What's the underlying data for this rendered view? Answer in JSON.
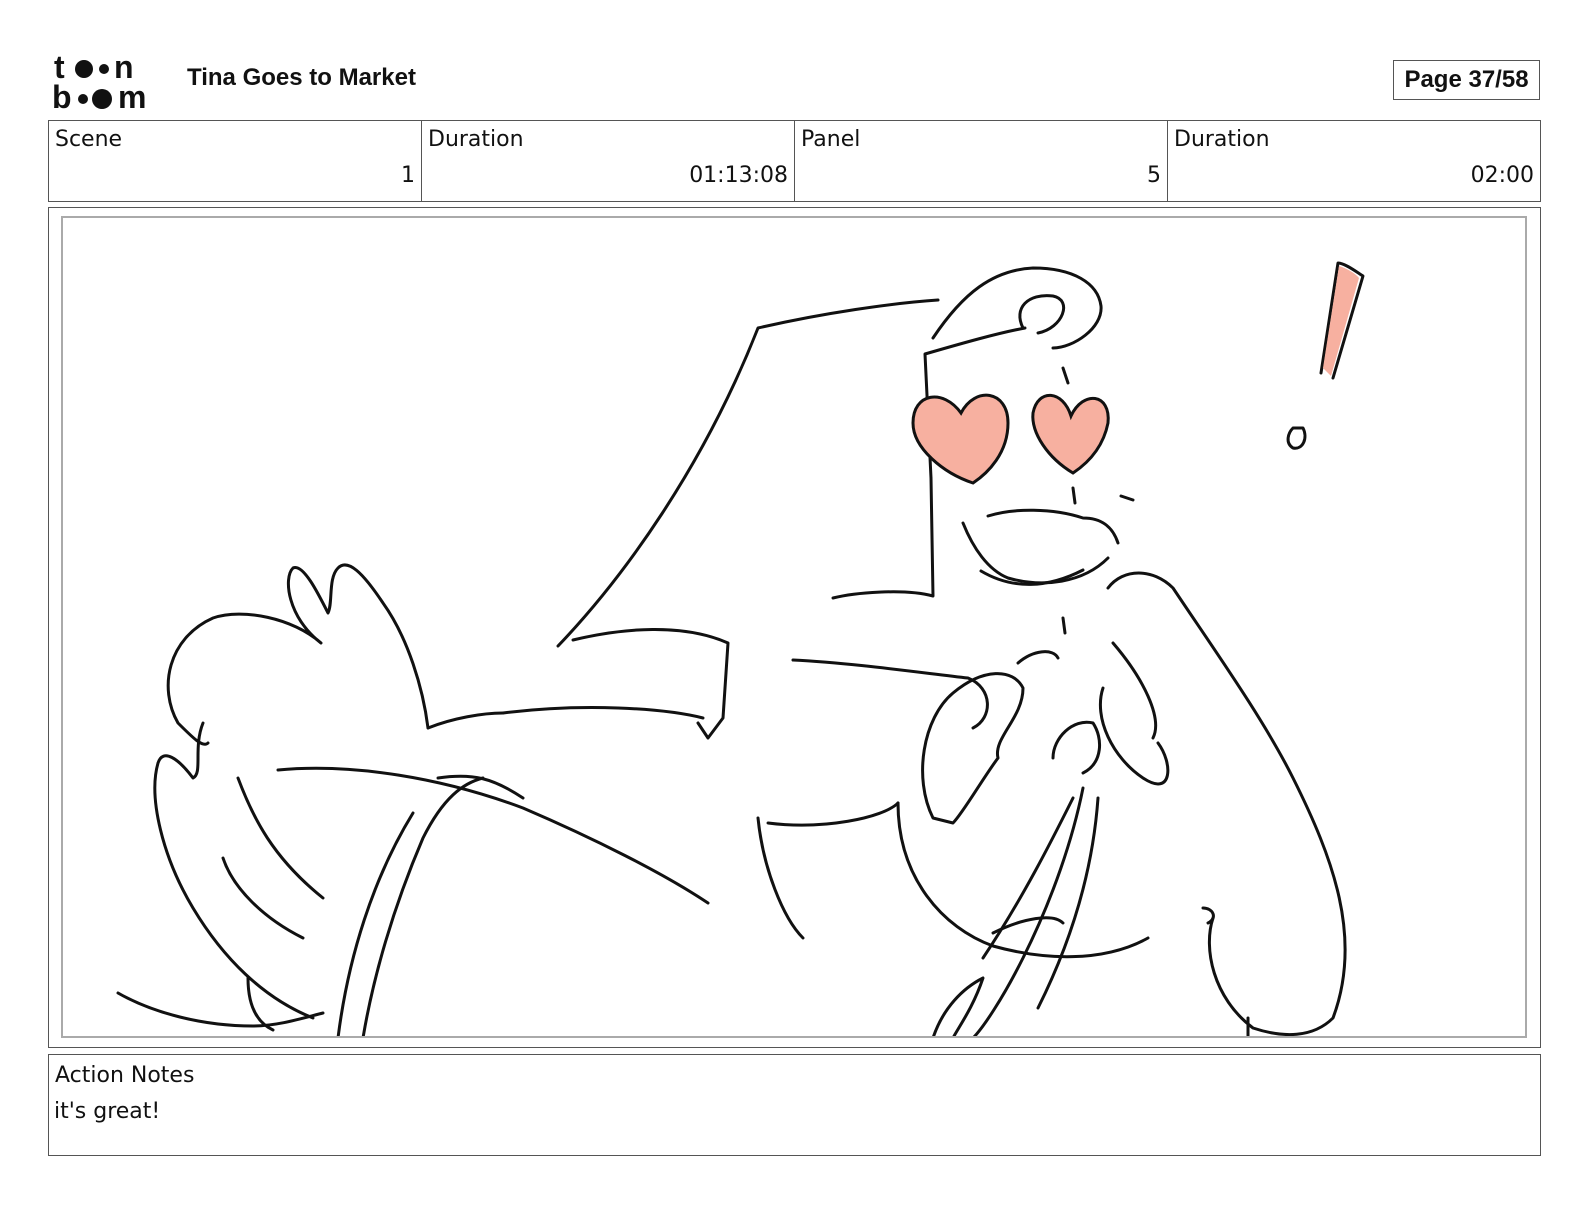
{
  "header": {
    "logo_text": "toon boom",
    "project_title": "Tina Goes to Market",
    "page_label": "Page 37/58"
  },
  "info": {
    "scene_label": "Scene",
    "scene_value": "1",
    "scene_duration_label": "Duration",
    "scene_duration_value": "01:13:08",
    "panel_label": "Panel",
    "panel_value": "5",
    "panel_duration_label": "Duration",
    "panel_duration_value": "02:00"
  },
  "notes": {
    "label": "Action Notes",
    "text": "it's great!"
  },
  "colors": {
    "accent_pink": "#f7b0a0",
    "line": "#111111"
  }
}
